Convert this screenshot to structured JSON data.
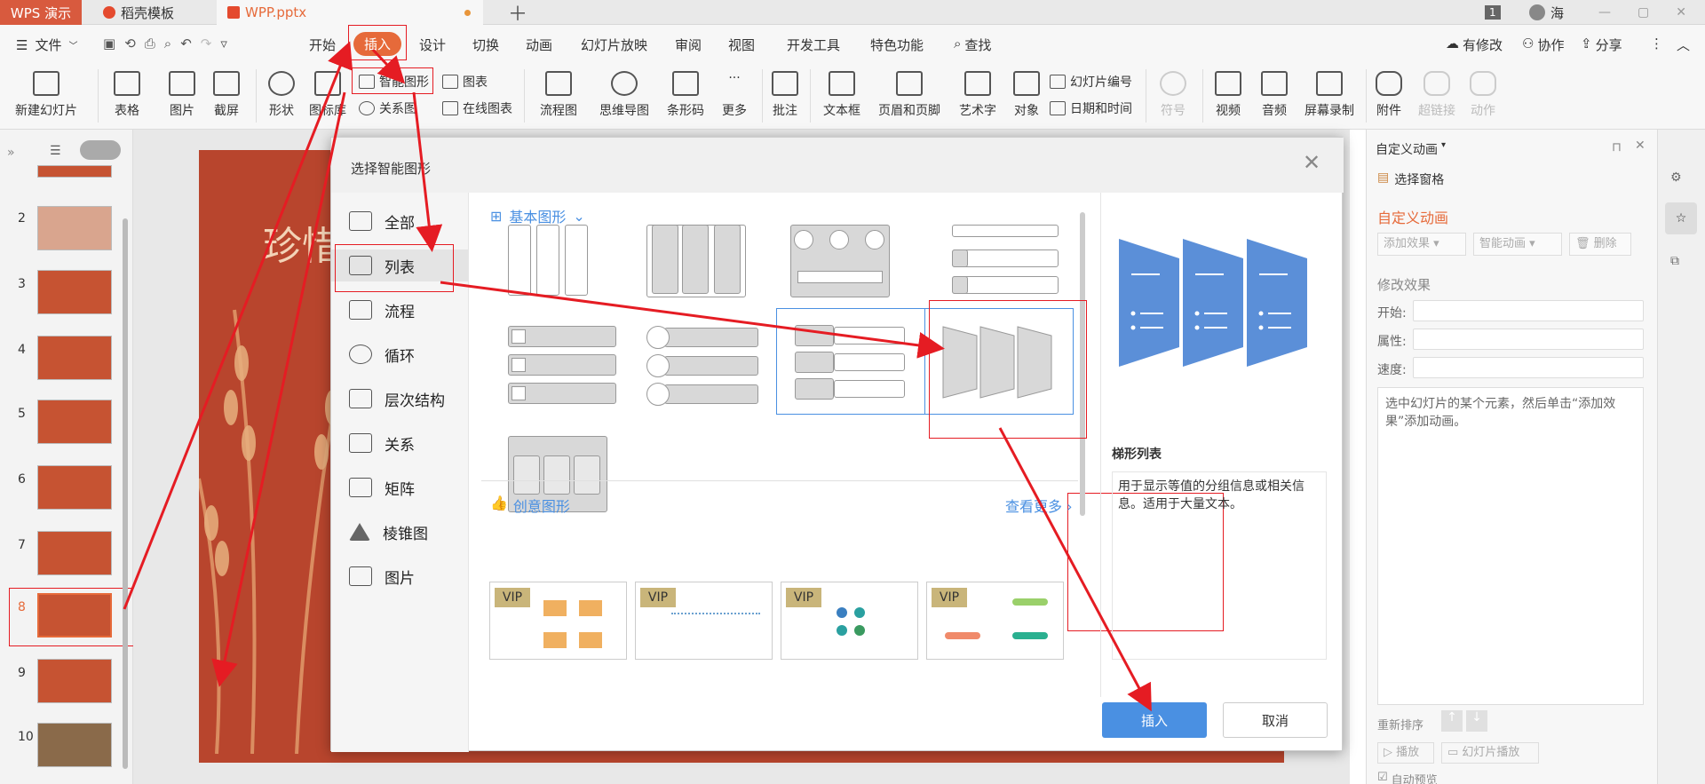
{
  "titlebar": {
    "tabs": [
      "WPS 演示",
      "稻壳模板",
      "WPP.pptx"
    ],
    "page_badge": "1",
    "user": "海"
  },
  "menu": {
    "file": "文件",
    "items": [
      "开始",
      "插入",
      "设计",
      "切换",
      "动画",
      "幻灯片放映",
      "审阅",
      "视图",
      "开发工具",
      "特色功能"
    ],
    "search": "查找",
    "right": [
      "有修改",
      "协作",
      "分享"
    ]
  },
  "ribbon": {
    "large": [
      "新建幻灯片",
      "表格",
      "图片",
      "截屏",
      "形状",
      "图标库",
      "流程图",
      "思维导图",
      "条形码",
      "更多",
      "批注",
      "文本框",
      "页眉和页脚",
      "艺术字",
      "对象",
      "符号",
      "视频",
      "音频",
      "屏幕录制",
      "附件",
      "超链接",
      "动作"
    ],
    "small": [
      "智能图形",
      "图表",
      "关系图",
      "在线图表",
      "幻灯片编号",
      "日期和时间"
    ]
  },
  "slides": {
    "numbers": [
      "2",
      "3",
      "4",
      "5",
      "6",
      "7",
      "8",
      "9",
      "10"
    ],
    "selected": "8",
    "slide_title": "珍惜"
  },
  "dialog": {
    "title": "选择智能图形",
    "nav": [
      "全部",
      "列表",
      "流程",
      "循环",
      "层次结构",
      "关系",
      "矩阵",
      "棱锥图",
      "图片"
    ],
    "section_basic": "基本图形",
    "section_creative": "创意图形",
    "see_more": "查看更多",
    "vip": "VIP",
    "preview_title": "梯形列表",
    "preview_desc": "用于显示等值的分组信息或相关信息。适用于大量文本。",
    "insert_btn": "插入",
    "cancel_btn": "取消"
  },
  "rightpanel": {
    "header": "自定义动画",
    "select_pane": "选择窗格",
    "section_title": "自定义动画",
    "add_effect": "添加效果",
    "smart_anim": "智能动画",
    "delete": "删除",
    "modify": "修改效果",
    "start": "开始:",
    "property": "属性:",
    "speed": "速度:",
    "hint": "选中幻灯片的某个元素，然后单击“添加效果”添加动画。",
    "reorder": "重新排序",
    "play": "播放",
    "slideshow": "幻灯片播放",
    "autopreview": "自动预览"
  },
  "colors": {
    "accent": "#e66a3a",
    "brand": "#d85a3e",
    "blue": "#4a90e2",
    "red": "#e51c23",
    "slide": "#b8452d"
  }
}
